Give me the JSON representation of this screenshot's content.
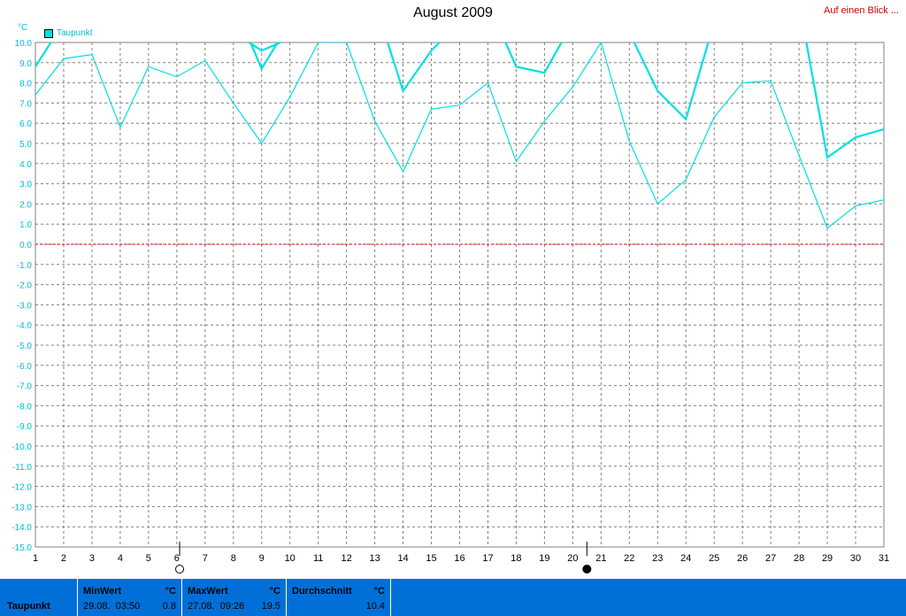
{
  "header": {
    "title": "August 2009",
    "link_label": "Auf einen Blick ..."
  },
  "chart_data": {
    "type": "line",
    "unit": "°C",
    "legend": [
      "Taupunkt"
    ],
    "legend_placement": "top-left",
    "grid": true,
    "xlim": [
      1,
      31
    ],
    "ylim": [
      -15,
      10
    ],
    "x_ticks": [
      "1",
      "2",
      "3",
      "4",
      "5",
      "6",
      "7",
      "8",
      "9",
      "10",
      "11",
      "12",
      "13",
      "14",
      "15",
      "16",
      "17",
      "18",
      "19",
      "20",
      "21",
      "22",
      "23",
      "24",
      "25",
      "26",
      "27",
      "28",
      "29",
      "30",
      "31"
    ],
    "y_ticks": [
      "10.0",
      "9.0",
      "8.0",
      "7.0",
      "6.0",
      "5.0",
      "4.0",
      "3.0",
      "2.0",
      "1.0",
      "0.0",
      "-1.0",
      "-2.0",
      "-3.0",
      "-4.0",
      "-5.0",
      "-6.0",
      "-7.0",
      "-8.0",
      "-9.0",
      "-10.0",
      "-11.0",
      "-12.0",
      "-13.0",
      "-14.0",
      "-15.0"
    ],
    "reference_line": {
      "y": 0,
      "color": "#cc0000"
    },
    "series": [
      {
        "name": "Taupunkt",
        "role": "max",
        "color": "#00e0e0",
        "x": [
          1,
          2,
          3,
          4,
          5,
          6,
          7,
          8,
          9,
          10,
          11,
          12,
          13,
          14,
          15,
          16,
          17,
          18,
          19,
          20,
          21,
          22,
          23,
          24,
          25,
          26,
          27,
          28,
          29,
          30,
          31
        ],
        "y": [
          8.8,
          11,
          12,
          10,
          11,
          11,
          12,
          12,
          8.7,
          11,
          12,
          12,
          12,
          7.6,
          9.6,
          11,
          12,
          8.8,
          8.5,
          11,
          12,
          10.5,
          7.6,
          6.2,
          11,
          12,
          12,
          12,
          4.3,
          5.3,
          5.7
        ]
      },
      {
        "name": "Taupunkt",
        "role": "min",
        "color": "#00e0e0",
        "x": [
          1,
          2,
          3,
          4,
          5,
          6,
          7,
          8,
          9,
          10,
          11,
          12,
          13,
          14,
          15,
          16,
          17,
          18,
          19,
          20,
          21,
          22,
          23,
          24,
          25,
          26,
          27,
          28,
          29,
          30,
          31
        ],
        "y": [
          7.4,
          9.2,
          9.4,
          5.8,
          8.8,
          8.3,
          9.1,
          7.0,
          5.0,
          7.3,
          10.0,
          10.0,
          6.1,
          3.6,
          6.7,
          6.9,
          8.0,
          4.1,
          6.1,
          7.8,
          10.0,
          5.1,
          2.0,
          3.2,
          6.3,
          8.0,
          8.1,
          4.4,
          0.8,
          1.9,
          2.2
        ]
      },
      {
        "name": "Taupunkt",
        "role": "avg",
        "color": "#00e0e0",
        "x": [
          8,
          9,
          10
        ],
        "y": [
          10.5,
          9.6,
          10.2
        ]
      }
    ],
    "moon_markers": [
      {
        "x": 6.1,
        "phase": "full"
      },
      {
        "x": 20.5,
        "phase": "new"
      }
    ]
  },
  "footer": {
    "label": "Taupunkt",
    "min": {
      "header": "MinWert",
      "unit": "°C",
      "date": "29.08.",
      "time": "03:50",
      "value": "0.8"
    },
    "max": {
      "header": "MaxWert",
      "unit": "°C",
      "date": "27.08.",
      "time": "09:26",
      "value": "19.5"
    },
    "avg": {
      "header": "Durchschnitt",
      "unit": "°C",
      "value": "10.4"
    }
  }
}
